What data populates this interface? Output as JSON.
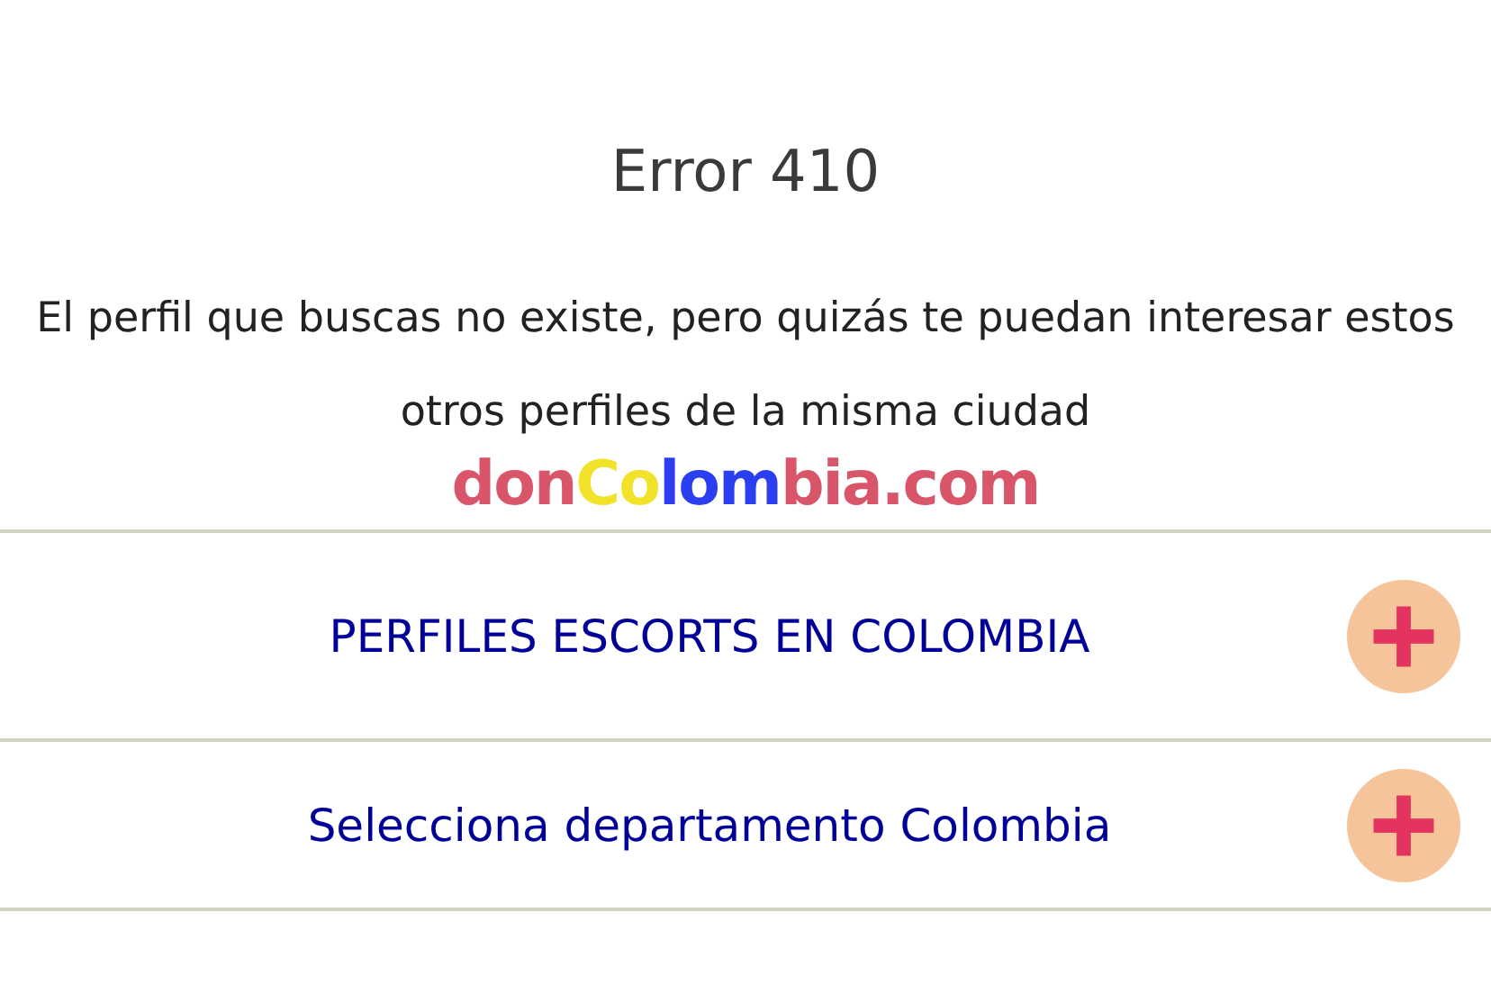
{
  "title": "Error 410",
  "message": "El perfil que buscas no existe, pero quizás te puedan interesar estos otros perfiles de la misma ciudad",
  "logo": [
    {
      "text": "don",
      "color": "#d9556a"
    },
    {
      "text": "Co",
      "color": "#f2e22a"
    },
    {
      "text": "lom",
      "color": "#2b3ff0"
    },
    {
      "text": "bia.com",
      "color": "#d9556a"
    }
  ],
  "sections": [
    {
      "label": "PERFILES ESCORTS EN COLOMBIA",
      "expanded": false
    },
    {
      "label": "Selecciona departamento Colombia",
      "expanded": false
    }
  ]
}
